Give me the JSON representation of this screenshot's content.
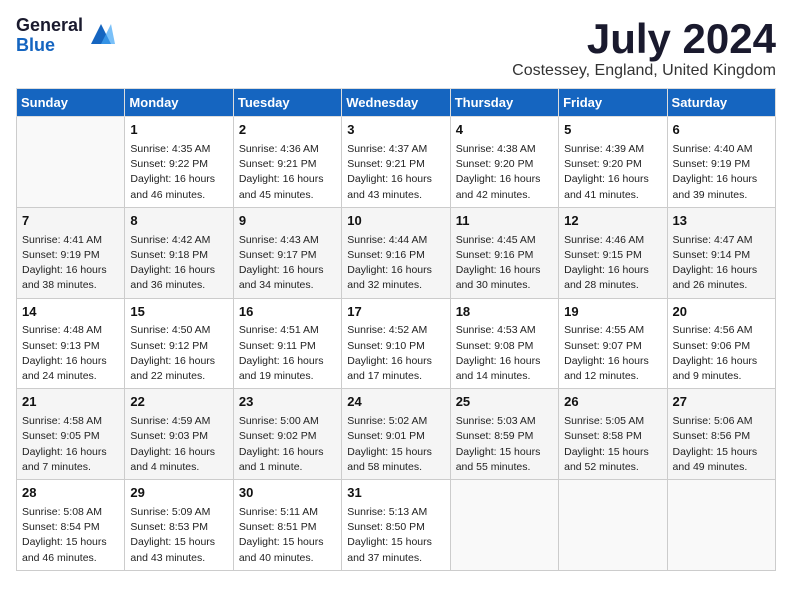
{
  "header": {
    "logo_general": "General",
    "logo_blue": "Blue",
    "month_title": "July 2024",
    "location": "Costessey, England, United Kingdom"
  },
  "days_of_week": [
    "Sunday",
    "Monday",
    "Tuesday",
    "Wednesday",
    "Thursday",
    "Friday",
    "Saturday"
  ],
  "weeks": [
    [
      {
        "day": "",
        "sunrise": "",
        "sunset": "",
        "daylight": ""
      },
      {
        "day": "1",
        "sunrise": "Sunrise: 4:35 AM",
        "sunset": "Sunset: 9:22 PM",
        "daylight": "Daylight: 16 hours and 46 minutes."
      },
      {
        "day": "2",
        "sunrise": "Sunrise: 4:36 AM",
        "sunset": "Sunset: 9:21 PM",
        "daylight": "Daylight: 16 hours and 45 minutes."
      },
      {
        "day": "3",
        "sunrise": "Sunrise: 4:37 AM",
        "sunset": "Sunset: 9:21 PM",
        "daylight": "Daylight: 16 hours and 43 minutes."
      },
      {
        "day": "4",
        "sunrise": "Sunrise: 4:38 AM",
        "sunset": "Sunset: 9:20 PM",
        "daylight": "Daylight: 16 hours and 42 minutes."
      },
      {
        "day": "5",
        "sunrise": "Sunrise: 4:39 AM",
        "sunset": "Sunset: 9:20 PM",
        "daylight": "Daylight: 16 hours and 41 minutes."
      },
      {
        "day": "6",
        "sunrise": "Sunrise: 4:40 AM",
        "sunset": "Sunset: 9:19 PM",
        "daylight": "Daylight: 16 hours and 39 minutes."
      }
    ],
    [
      {
        "day": "7",
        "sunrise": "Sunrise: 4:41 AM",
        "sunset": "Sunset: 9:19 PM",
        "daylight": "Daylight: 16 hours and 38 minutes."
      },
      {
        "day": "8",
        "sunrise": "Sunrise: 4:42 AM",
        "sunset": "Sunset: 9:18 PM",
        "daylight": "Daylight: 16 hours and 36 minutes."
      },
      {
        "day": "9",
        "sunrise": "Sunrise: 4:43 AM",
        "sunset": "Sunset: 9:17 PM",
        "daylight": "Daylight: 16 hours and 34 minutes."
      },
      {
        "day": "10",
        "sunrise": "Sunrise: 4:44 AM",
        "sunset": "Sunset: 9:16 PM",
        "daylight": "Daylight: 16 hours and 32 minutes."
      },
      {
        "day": "11",
        "sunrise": "Sunrise: 4:45 AM",
        "sunset": "Sunset: 9:16 PM",
        "daylight": "Daylight: 16 hours and 30 minutes."
      },
      {
        "day": "12",
        "sunrise": "Sunrise: 4:46 AM",
        "sunset": "Sunset: 9:15 PM",
        "daylight": "Daylight: 16 hours and 28 minutes."
      },
      {
        "day": "13",
        "sunrise": "Sunrise: 4:47 AM",
        "sunset": "Sunset: 9:14 PM",
        "daylight": "Daylight: 16 hours and 26 minutes."
      }
    ],
    [
      {
        "day": "14",
        "sunrise": "Sunrise: 4:48 AM",
        "sunset": "Sunset: 9:13 PM",
        "daylight": "Daylight: 16 hours and 24 minutes."
      },
      {
        "day": "15",
        "sunrise": "Sunrise: 4:50 AM",
        "sunset": "Sunset: 9:12 PM",
        "daylight": "Daylight: 16 hours and 22 minutes."
      },
      {
        "day": "16",
        "sunrise": "Sunrise: 4:51 AM",
        "sunset": "Sunset: 9:11 PM",
        "daylight": "Daylight: 16 hours and 19 minutes."
      },
      {
        "day": "17",
        "sunrise": "Sunrise: 4:52 AM",
        "sunset": "Sunset: 9:10 PM",
        "daylight": "Daylight: 16 hours and 17 minutes."
      },
      {
        "day": "18",
        "sunrise": "Sunrise: 4:53 AM",
        "sunset": "Sunset: 9:08 PM",
        "daylight": "Daylight: 16 hours and 14 minutes."
      },
      {
        "day": "19",
        "sunrise": "Sunrise: 4:55 AM",
        "sunset": "Sunset: 9:07 PM",
        "daylight": "Daylight: 16 hours and 12 minutes."
      },
      {
        "day": "20",
        "sunrise": "Sunrise: 4:56 AM",
        "sunset": "Sunset: 9:06 PM",
        "daylight": "Daylight: 16 hours and 9 minutes."
      }
    ],
    [
      {
        "day": "21",
        "sunrise": "Sunrise: 4:58 AM",
        "sunset": "Sunset: 9:05 PM",
        "daylight": "Daylight: 16 hours and 7 minutes."
      },
      {
        "day": "22",
        "sunrise": "Sunrise: 4:59 AM",
        "sunset": "Sunset: 9:03 PM",
        "daylight": "Daylight: 16 hours and 4 minutes."
      },
      {
        "day": "23",
        "sunrise": "Sunrise: 5:00 AM",
        "sunset": "Sunset: 9:02 PM",
        "daylight": "Daylight: 16 hours and 1 minute."
      },
      {
        "day": "24",
        "sunrise": "Sunrise: 5:02 AM",
        "sunset": "Sunset: 9:01 PM",
        "daylight": "Daylight: 15 hours and 58 minutes."
      },
      {
        "day": "25",
        "sunrise": "Sunrise: 5:03 AM",
        "sunset": "Sunset: 8:59 PM",
        "daylight": "Daylight: 15 hours and 55 minutes."
      },
      {
        "day": "26",
        "sunrise": "Sunrise: 5:05 AM",
        "sunset": "Sunset: 8:58 PM",
        "daylight": "Daylight: 15 hours and 52 minutes."
      },
      {
        "day": "27",
        "sunrise": "Sunrise: 5:06 AM",
        "sunset": "Sunset: 8:56 PM",
        "daylight": "Daylight: 15 hours and 49 minutes."
      }
    ],
    [
      {
        "day": "28",
        "sunrise": "Sunrise: 5:08 AM",
        "sunset": "Sunset: 8:54 PM",
        "daylight": "Daylight: 15 hours and 46 minutes."
      },
      {
        "day": "29",
        "sunrise": "Sunrise: 5:09 AM",
        "sunset": "Sunset: 8:53 PM",
        "daylight": "Daylight: 15 hours and 43 minutes."
      },
      {
        "day": "30",
        "sunrise": "Sunrise: 5:11 AM",
        "sunset": "Sunset: 8:51 PM",
        "daylight": "Daylight: 15 hours and 40 minutes."
      },
      {
        "day": "31",
        "sunrise": "Sunrise: 5:13 AM",
        "sunset": "Sunset: 8:50 PM",
        "daylight": "Daylight: 15 hours and 37 minutes."
      },
      {
        "day": "",
        "sunrise": "",
        "sunset": "",
        "daylight": ""
      },
      {
        "day": "",
        "sunrise": "",
        "sunset": "",
        "daylight": ""
      },
      {
        "day": "",
        "sunrise": "",
        "sunset": "",
        "daylight": ""
      }
    ]
  ]
}
